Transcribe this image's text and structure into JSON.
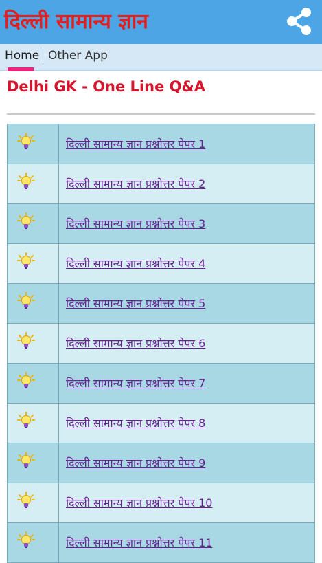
{
  "header": {
    "title": "दिल्ली सामान्य ज्ञान",
    "share_icon": "share-icon",
    "background": "#4ca5e4",
    "title_color": "#e02020"
  },
  "tabs": [
    {
      "label": "Home",
      "active": true
    },
    {
      "label": "Other App",
      "active": false
    }
  ],
  "tab_indicator_color": "#e8257a",
  "page": {
    "heading": "Delhi GK - One Line Q&A",
    "heading_color": "#d4152b"
  },
  "list": {
    "row_icon": "lightbulb-icon",
    "row_colors": [
      "#a8d8e4",
      "#d5eef3"
    ],
    "link_color": "#6b1f93",
    "items": [
      {
        "label": "दिल्ली सामान्य ज्ञान प्रश्नोत्तर पेपर 1"
      },
      {
        "label": "दिल्ली सामान्य ज्ञान प्रश्नोत्तर पेपर 2"
      },
      {
        "label": "दिल्ली सामान्य ज्ञान प्रश्नोत्तर पेपर 3"
      },
      {
        "label": "दिल्ली सामान्य ज्ञान प्रश्नोत्तर पेपर 4"
      },
      {
        "label": "दिल्ली सामान्य ज्ञान प्रश्नोत्तर पेपर 5"
      },
      {
        "label": "दिल्ली सामान्य ज्ञान प्रश्नोत्तर पेपर 6"
      },
      {
        "label": "दिल्ली सामान्य ज्ञान प्रश्नोत्तर पेपर 7"
      },
      {
        "label": "दिल्ली सामान्य ज्ञान प्रश्नोत्तर पेपर 8"
      },
      {
        "label": "दिल्ली सामान्य ज्ञान प्रश्नोत्तर पेपर 9"
      },
      {
        "label": "दिल्ली सामान्य ज्ञान प्रश्नोत्तर पेपर 10"
      },
      {
        "label": "दिल्ली सामान्य ज्ञान प्रश्नोत्तर पेपर 11"
      }
    ]
  }
}
